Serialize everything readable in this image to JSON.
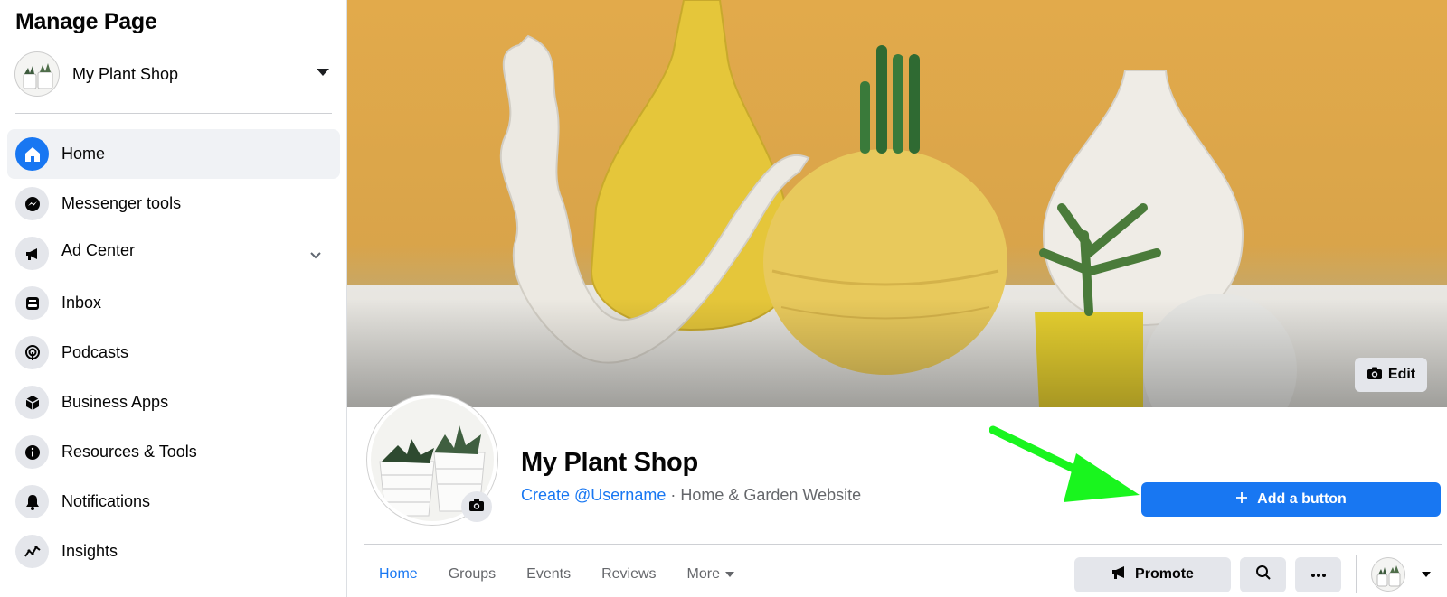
{
  "sidebar": {
    "title": "Manage Page",
    "page_name": "My Plant Shop",
    "items": [
      {
        "label": "Home",
        "icon": "home-icon",
        "active": true
      },
      {
        "label": "Messenger tools",
        "icon": "messenger-icon"
      },
      {
        "label": "Ad Center",
        "icon": "megaphone-icon",
        "expandable": true
      },
      {
        "label": "Inbox",
        "icon": "inbox-icon"
      },
      {
        "label": "Podcasts",
        "icon": "podcast-icon"
      },
      {
        "label": "Business Apps",
        "icon": "cube-icon"
      },
      {
        "label": "Resources & Tools",
        "icon": "info-icon"
      },
      {
        "label": "Notifications",
        "icon": "bell-icon"
      },
      {
        "label": "Insights",
        "icon": "insights-icon"
      }
    ]
  },
  "cover": {
    "edit_label": "Edit"
  },
  "profile": {
    "name": "My Plant Shop",
    "username_link": "Create @Username",
    "separator": " · ",
    "category": "Home & Garden Website",
    "add_button_label": "Add a button"
  },
  "tabs": [
    {
      "label": "Home",
      "active": true
    },
    {
      "label": "Groups"
    },
    {
      "label": "Events"
    },
    {
      "label": "Reviews"
    },
    {
      "label": "More"
    }
  ],
  "actions": {
    "promote_label": "Promote"
  },
  "colors": {
    "brand_blue": "#1877f2",
    "annotation_arrow": "#19f51e"
  }
}
